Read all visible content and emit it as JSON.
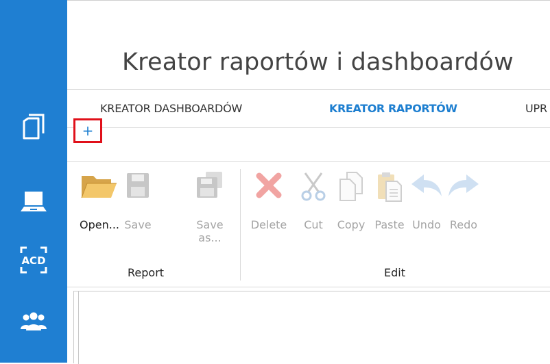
{
  "app": {
    "title": "Kreator raportów i dashboardów"
  },
  "sidebar": {
    "items": [
      {
        "icon": "documents-icon"
      },
      {
        "icon": "laptop-icon"
      },
      {
        "icon": "acd-scan-icon",
        "label": "ACD"
      },
      {
        "icon": "users-group-icon"
      }
    ]
  },
  "tabs": [
    {
      "label": "KREATOR DASHBOARDÓW",
      "active": false
    },
    {
      "label": "KREATOR RAPORTÓW",
      "active": true
    },
    {
      "label": "UPR",
      "active": false
    }
  ],
  "new_tab": {
    "label": "+"
  },
  "ribbon": {
    "groups": [
      {
        "label": "Report"
      },
      {
        "label": "Edit"
      }
    ],
    "buttons": [
      {
        "label": "Open...",
        "icon": "folder-open-icon",
        "enabled": true
      },
      {
        "label": "Save",
        "icon": "save-icon",
        "enabled": false
      },
      {
        "label": "Save\nas...",
        "icon": "save-as-icon",
        "enabled": false
      },
      {
        "label": "Delete",
        "icon": "delete-icon",
        "enabled": false
      },
      {
        "label": "Cut",
        "icon": "scissors-icon",
        "enabled": false
      },
      {
        "label": "Copy",
        "icon": "copy-icon",
        "enabled": false
      },
      {
        "label": "Paste",
        "icon": "paste-icon",
        "enabled": false
      },
      {
        "label": "Undo",
        "icon": "undo-icon",
        "enabled": false
      },
      {
        "label": "Redo",
        "icon": "redo-icon",
        "enabled": false
      }
    ]
  },
  "colors": {
    "sidebar": "#1f7fd2",
    "active_tab": "#1e7fd0",
    "highlight_border": "#e0101a",
    "disabled_text": "#a5a5a5"
  }
}
